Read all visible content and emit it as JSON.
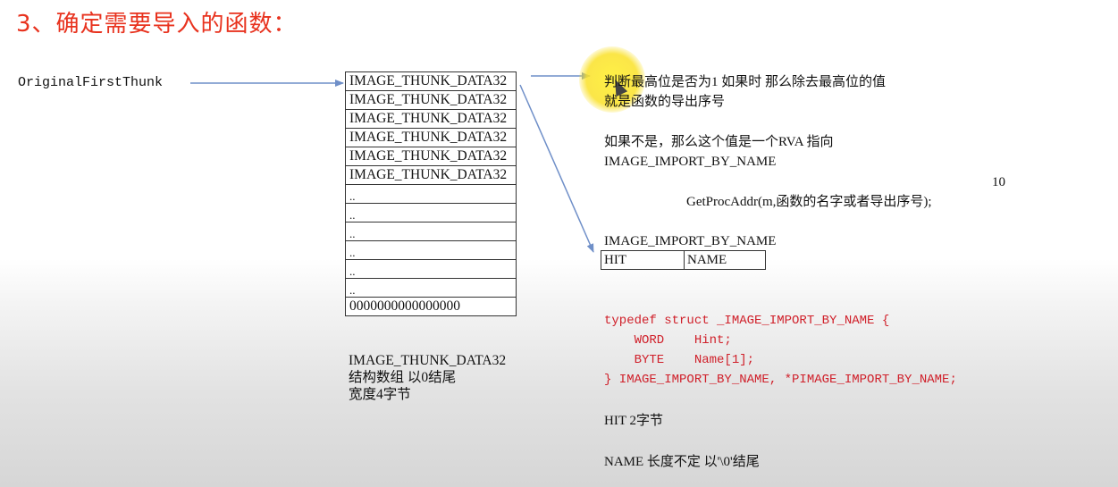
{
  "title": "3、确定需要导入的函数：",
  "left_label": "OriginalFirstThunk",
  "thunk_rows": [
    "IMAGE_THUNK_DATA32",
    "IMAGE_THUNK_DATA32",
    "IMAGE_THUNK_DATA32",
    "IMAGE_THUNK_DATA32",
    "IMAGE_THUNK_DATA32",
    "IMAGE_THUNK_DATA32",
    "..",
    "..",
    "..",
    "..",
    "..",
    "..",
    "0000000000000000"
  ],
  "thunk_caption": {
    "line1": "IMAGE_THUNK_DATA32",
    "line2": "结构数组 以0结尾",
    "line3": "宽度4字节"
  },
  "notes": {
    "line1": "判断最高位是否为1 如果时 那么除去最高位的值",
    "line2": "就是函数的导出序号",
    "line3": "如果不是，那么这个值是一个RVA 指向",
    "line4": "IMAGE_IMPORT_BY_NAME",
    "num": "10",
    "call": "GetProcAddr(m,函数的名字或者导出序号);"
  },
  "import_by_name": {
    "label": "IMAGE_IMPORT_BY_NAME",
    "fields": [
      "HIT",
      "NAME"
    ]
  },
  "code": {
    "line1": "typedef struct _IMAGE_IMPORT_BY_NAME {",
    "line2": "    WORD    Hint;",
    "line3": "    BYTE    Name[1];",
    "line4": "} IMAGE_IMPORT_BY_NAME, *PIMAGE_IMPORT_BY_NAME;"
  },
  "footer": {
    "hit": "HIT 2字节",
    "name": "NAME 长度不定 以'\\0'结尾"
  },
  "colors": {
    "title": "#e8321e",
    "code": "#d0202a",
    "arrow": "#6f8fc8",
    "highlight": "#f5e52a"
  }
}
